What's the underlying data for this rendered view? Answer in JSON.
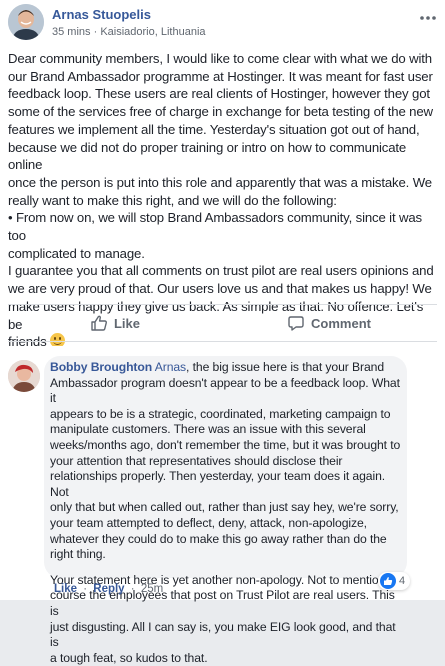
{
  "post": {
    "author": "Arnas Stuopelis",
    "time": "35 mins",
    "separator": "·",
    "location": "Kaisiadorio, Lithuania",
    "body_lines": [
      "Dear community members, I would like to come clear with what we do with",
      "our Brand Ambassador programme at Hostinger. It was meant for fast user",
      "feedback loop. These users are real clients of Hostinger, however they got",
      "some of the services free of charge in exchange for beta testing of the new",
      "features we implement all the time. Yesterday's situation got out of hand,",
      "because we did not do proper training or intro on how to communicate online",
      "once the person is put into this role and apparently that was a mistake. We",
      "really want to make this right, and we will do the following:",
      "• From now on, we will stop Brand Ambassadors community, since it was too",
      "complicated to manage.",
      "I guarantee you that all comments on trust pilot are real users opinions and",
      "we are very proud of that. Our users love us and that makes us happy! We",
      "make users happy they give us back. As simple as that. No offence. Let's be",
      "friends"
    ]
  },
  "actions": {
    "like_label": "Like",
    "comment_label": "Comment"
  },
  "comment": {
    "author": "Bobby Broughton",
    "tag": "Arnas",
    "para1_lines": [
      ", the big issue here is that your Brand",
      "Ambassador program doesn't appear to be a feedback loop. What it",
      "appears to be is a strategic, coordinated, marketing campaign to",
      "manipulate customers. There was an issue with this several",
      "weeks/months ago, don't remember the time, but it was brought to",
      "your attention that representatives should disclose their",
      "relationships properly. Then yesterday, your team does it again. Not",
      "only that but when called out, rather than just say hey, we're sorry,",
      "your team attempted to deflect, deny, attack, non-apologize,",
      "whatever they could do to make this go away rather than do the",
      "right thing."
    ],
    "para2_lines": [
      "Your statement here is yet another non-apology. Not to mention, of",
      "course the employees that post on Trust Pilot are real users. This is",
      "just disgusting. All I can say is, you make EIG look good, and that is",
      "a tough feat, so kudos to that."
    ],
    "reaction_count": "4",
    "like_label": "Like",
    "reply_label": "Reply",
    "separator": "·",
    "time": "25m"
  },
  "colors": {
    "link": "#385898",
    "meta": "#606770",
    "bubble": "#f2f3f5",
    "like_blue": "#1877f2"
  }
}
